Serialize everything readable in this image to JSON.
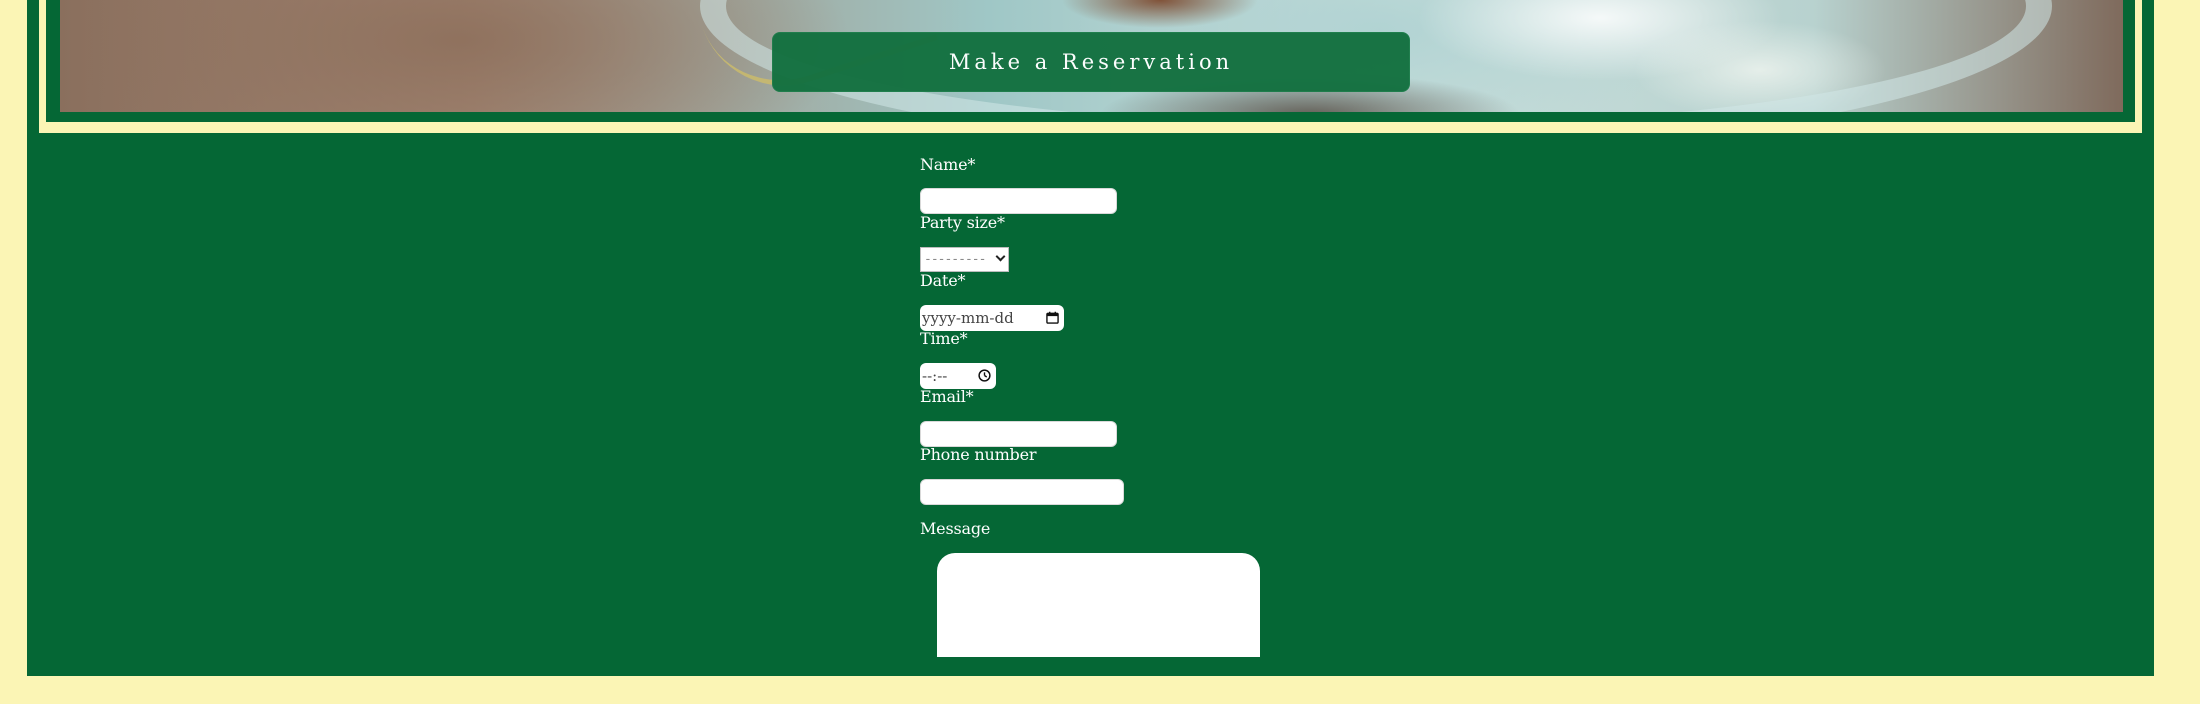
{
  "hero": {
    "reserve_button_label": "Make a Reservation"
  },
  "form": {
    "name_label": "Name*",
    "party_size_label": "Party size*",
    "party_size_value": "---------",
    "date_label": "Date*",
    "date_placeholder": "yyyy-mm-dd",
    "time_label": "Time*",
    "time_placeholder": "--:--",
    "email_label": "Email*",
    "phone_label": "Phone number",
    "message_label": "Message"
  },
  "colors": {
    "background": "#fbf5b5",
    "panel_green": "#056735",
    "button_green": "#12703f"
  },
  "icons": {
    "date_picker": "calendar-icon",
    "time_picker": "clock-icon",
    "select_arrow": "chevron-down-icon"
  }
}
